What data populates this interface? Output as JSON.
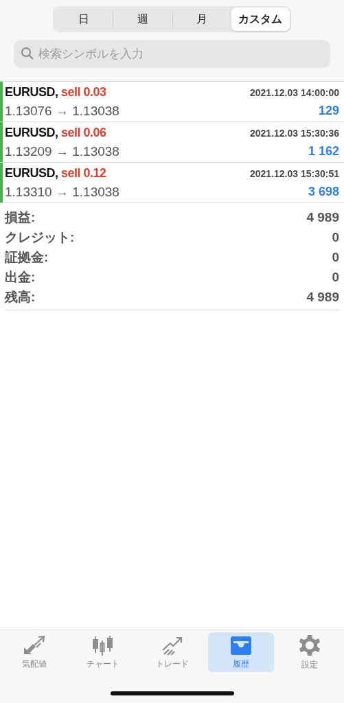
{
  "period_tabs": [
    {
      "label": "日",
      "selected": false
    },
    {
      "label": "週",
      "selected": false
    },
    {
      "label": "月",
      "selected": false
    },
    {
      "label": "カスタム",
      "selected": true
    }
  ],
  "search": {
    "placeholder": "検索シンボルを入力"
  },
  "deals": [
    {
      "symbol": "EURUSD,",
      "side": "sell 0.03",
      "time": "2021.12.03 14:00:00",
      "prices": "1.13076 → 1.13038",
      "profit": "129"
    },
    {
      "symbol": "EURUSD,",
      "side": "sell 0.06",
      "time": "2021.12.03 15:30:36",
      "prices": "1.13209 → 1.13038",
      "profit": "1 162"
    },
    {
      "symbol": "EURUSD,",
      "side": "sell 0.12",
      "time": "2021.12.03 15:30:51",
      "prices": "1.13310 → 1.13038",
      "profit": "3 698"
    }
  ],
  "summary": [
    {
      "label": "損益:",
      "value": "4 989"
    },
    {
      "label": "クレジット:",
      "value": "0"
    },
    {
      "label": "証拠金:",
      "value": "0"
    },
    {
      "label": "出金:",
      "value": "0"
    },
    {
      "label": "残高:",
      "value": "4 989"
    }
  ],
  "tab_bar": [
    {
      "label": "気配値",
      "selected": false
    },
    {
      "label": "チャート",
      "selected": false
    },
    {
      "label": "トレード",
      "selected": false
    },
    {
      "label": "履歴",
      "selected": true
    },
    {
      "label": "設定",
      "selected": false
    }
  ]
}
